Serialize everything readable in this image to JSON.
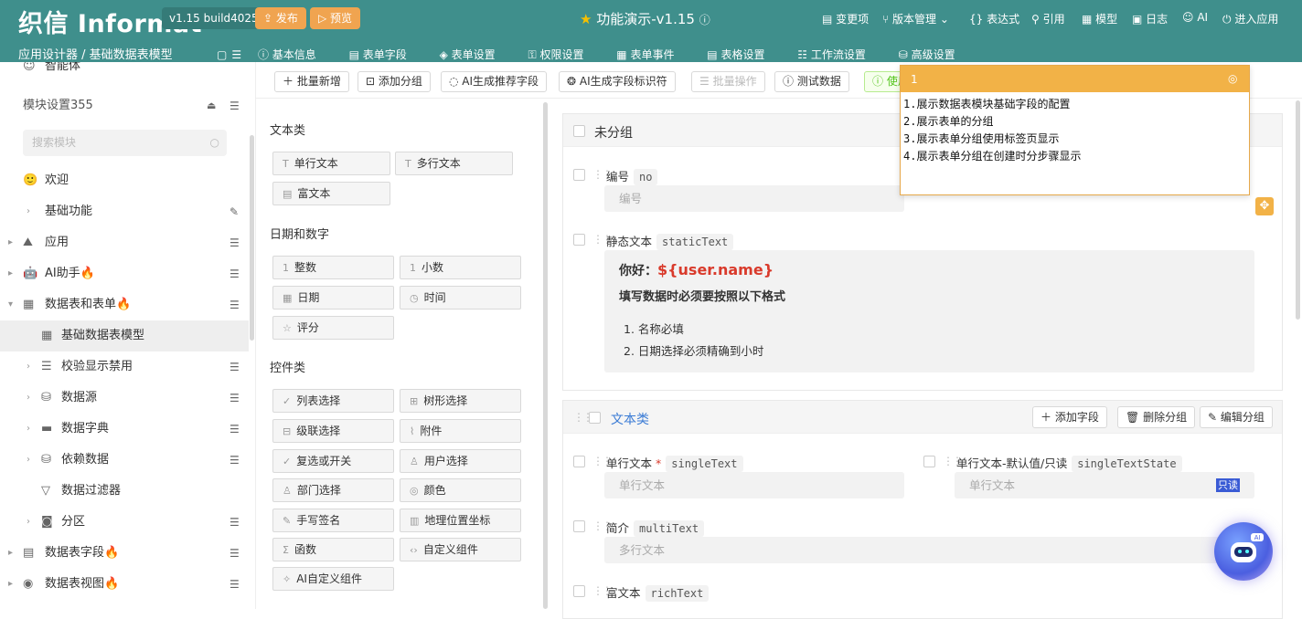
{
  "header": {
    "logo": "织信 Informat",
    "version": "v1.15 build4025",
    "publish": "发布",
    "preview": "预览",
    "title": "功能演示-v1.15",
    "menu": [
      "变更项",
      "版本管理",
      "表达式",
      "引用",
      "模型",
      "日志",
      "AI",
      "进入应用"
    ]
  },
  "subheader": {
    "breadcrumb": "应用设计器 / 基础数据表模型",
    "tabs": [
      "基本信息",
      "表单字段",
      "表单设置",
      "权限设置",
      "表单事件",
      "表格设置",
      "工作流设置",
      "高级设置"
    ]
  },
  "sidebar": {
    "partial_item": "智能体",
    "section": "模块设置355",
    "search_placeholder": "搜索模块",
    "items": [
      "欢迎",
      "基础功能",
      "应用",
      "AI助手🔥",
      "数据表和表单🔥",
      "基础数据表模型",
      "校验显示禁用",
      "数据源",
      "数据字典",
      "依赖数据",
      "数据过滤器",
      "分区",
      "数据表字段🔥",
      "数据表视图🔥"
    ]
  },
  "toolbar": {
    "buttons": [
      "批量新增",
      "添加分组",
      "AI生成推荐字段",
      "AI生成字段标识符",
      "批量操作",
      "测试数据",
      "使用"
    ]
  },
  "palette": {
    "categories": [
      "文本类",
      "日期和数字",
      "控件类"
    ],
    "text": [
      "单行文本",
      "多行文本",
      "富文本"
    ],
    "date": [
      "整数",
      "小数",
      "日期",
      "时间",
      "评分"
    ],
    "ctrl": [
      "列表选择",
      "树形选择",
      "级联选择",
      "附件",
      "复选或开关",
      "用户选择",
      "部门选择",
      "颜色",
      "手写签名",
      "地理位置坐标",
      "函数",
      "自定义组件",
      "AI自定义组件"
    ]
  },
  "groups": {
    "g1": {
      "name": "未分组",
      "f1_label": "编号",
      "f1_code": "no",
      "f1_ph": "编号",
      "f2_label": "静态文本",
      "f2_code": "staticText",
      "greet": "你好：",
      "var": "${user.name}",
      "heading": "填写数据时必须要按照以下格式",
      "list": [
        "1. 名称必填",
        "2. 日期选择必须精确到小时"
      ]
    },
    "g2": {
      "name": "文本类",
      "add": "添加字段",
      "del": "删除分组",
      "edit": "编辑分组",
      "f1_label": "单行文本",
      "req": "*",
      "f1_code": "singleText",
      "f1_ph": "单行文本",
      "f2_label": "单行文本-默认值/只读",
      "f2_code": "singleTextState",
      "f2_ph": "单行文本",
      "readonly": "只读",
      "f3_label": "简介",
      "f3_code": "multiText",
      "f3_ph": "多行文本",
      "f4_label": "富文本",
      "f4_code": "richText"
    }
  },
  "note": {
    "title": "1",
    "lines": [
      "1.展示数据表模块基础字段的配置",
      "2.展示表单的分组",
      "3.展示表单分组使用标签页显示",
      "4.展示表单分组在创建时分步骤显示"
    ]
  },
  "colors": {
    "brand": "#3f8f8c",
    "accent": "#f0a450",
    "link": "#3a7bd5",
    "danger": "#d93a2b"
  }
}
